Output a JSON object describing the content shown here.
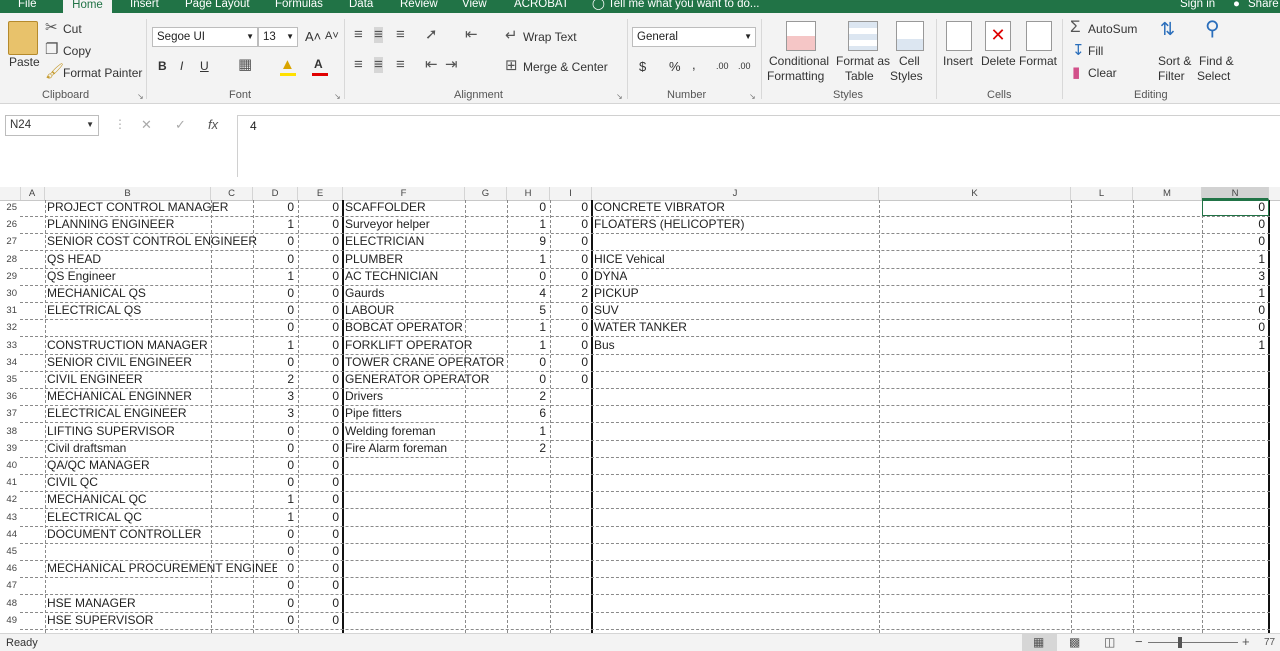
{
  "tabs": {
    "file": "File",
    "home": "Home",
    "insert": "Insert",
    "page_layout": "Page Layout",
    "formulas": "Formulas",
    "data": "Data",
    "review": "Review",
    "view": "View",
    "acrobat": "ACROBAT",
    "tell_me": "Tell me what you want to do...",
    "sign_in": "Sign in",
    "share": "Share"
  },
  "ribbon": {
    "clipboard": {
      "paste": "Paste",
      "cut": "Cut",
      "copy": "Copy",
      "format_painter": "Format Painter",
      "label": "Clipboard"
    },
    "font": {
      "name": "Segoe UI",
      "size": "13",
      "bold": "B",
      "italic": "I",
      "underline": "U",
      "label": "Font"
    },
    "alignment": {
      "wrap_text": "Wrap Text",
      "merge_center": "Merge & Center",
      "label": "Alignment"
    },
    "number": {
      "format": "General",
      "currency": "$",
      "percent": "%",
      "comma": ",",
      "inc_dec": ".00",
      "dec_dec": ".00",
      "label": "Number"
    },
    "styles": {
      "conditional": "Conditional",
      "conditional2": "Formatting",
      "format_as": "Format as",
      "format_as2": "Table",
      "cell": "Cell",
      "cell2": "Styles",
      "label": "Styles"
    },
    "cells": {
      "insert": "Insert",
      "delete": "Delete",
      "format": "Format",
      "label": "Cells"
    },
    "editing": {
      "autosum": "AutoSum",
      "fill": "Fill",
      "clear": "Clear",
      "sort": "Sort &",
      "sort2": "Filter",
      "find": "Find &",
      "find2": "Select",
      "label": "Editing"
    }
  },
  "formula_bar": {
    "name_box": "N24",
    "fx": "fx",
    "value": "4"
  },
  "columns": [
    "A",
    "B",
    "C",
    "D",
    "E",
    "F",
    "G",
    "H",
    "I",
    "J",
    "K",
    "L",
    "M",
    "N"
  ],
  "rows": [
    {
      "n": "25",
      "b": "PROJECT CONTROL MANAGER",
      "d": "0",
      "e": "0",
      "f": "SCAFFOLDER",
      "h": "0",
      "i": "0",
      "j": "CONCRETE VIBRATOR",
      "nn": "0"
    },
    {
      "n": "26",
      "b": "PLANNING ENGINEER",
      "d": "1",
      "e": "0",
      "f": "Surveyor helper",
      "h": "1",
      "i": "0",
      "j": "FLOATERS (HELICOPTER)",
      "nn": "0"
    },
    {
      "n": "27",
      "b": "SENIOR COST CONTROL ENGINEER",
      "d": "0",
      "e": "0",
      "f": "ELECTRICIAN",
      "h": "9",
      "i": "0",
      "j": "",
      "nn": "0"
    },
    {
      "n": "28",
      "b": "QS HEAD",
      "d": "0",
      "e": "0",
      "f": "PLUMBER",
      "h": "1",
      "i": "0",
      "j": "HICE Vehical",
      "nn": "1"
    },
    {
      "n": "29",
      "b": "QS Engineer",
      "d": "1",
      "e": "0",
      "f": "AC TECHNICIAN",
      "h": "0",
      "i": "0",
      "j": "DYNA",
      "nn": "3"
    },
    {
      "n": "30",
      "b": "MECHANICAL QS",
      "d": "0",
      "e": "0",
      "f": "Gaurds",
      "h": "4",
      "i": "2",
      "j": "PICKUP",
      "nn": "1"
    },
    {
      "n": "31",
      "b": "ELECTRICAL QS",
      "d": "0",
      "e": "0",
      "f": "LABOUR",
      "h": "5",
      "i": "0",
      "j": "SUV",
      "nn": "0"
    },
    {
      "n": "32",
      "b": "",
      "d": "0",
      "e": "0",
      "f": "BOBCAT OPERATOR",
      "h": "1",
      "i": "0",
      "j": "WATER TANKER",
      "nn": "0"
    },
    {
      "n": "33",
      "b": "CONSTRUCTION MANAGER",
      "d": "1",
      "e": "0",
      "f": "FORKLIFT OPERATOR",
      "h": "1",
      "i": "0",
      "j": "Bus",
      "nn": "1"
    },
    {
      "n": "34",
      "b": "SENIOR CIVIL ENGINEER",
      "d": "0",
      "e": "0",
      "f": "TOWER CRANE OPERATOR",
      "h": "0",
      "i": "0",
      "j": "",
      "nn": ""
    },
    {
      "n": "35",
      "b": "CIVIL ENGINEER",
      "d": "2",
      "e": "0",
      "f": "GENERATOR OPERATOR",
      "h": "0",
      "i": "0",
      "j": "",
      "nn": ""
    },
    {
      "n": "36",
      "b": "MECHANICAL ENGINNER",
      "d": "3",
      "e": "0",
      "f": "Drivers",
      "h": "2",
      "i": "",
      "j": "",
      "nn": ""
    },
    {
      "n": "37",
      "b": "ELECTRICAL ENGINEER",
      "d": "3",
      "e": "0",
      "f": "Pipe fitters",
      "h": "6",
      "i": "",
      "j": "",
      "nn": ""
    },
    {
      "n": "38",
      "b": "LIFTING SUPERVISOR",
      "d": "0",
      "e": "0",
      "f": "Welding foreman",
      "h": "1",
      "i": "",
      "j": "",
      "nn": ""
    },
    {
      "n": "39",
      "b": "Civil draftsman",
      "d": "0",
      "e": "0",
      "f": "Fire Alarm foreman",
      "h": "2",
      "i": "",
      "j": "",
      "nn": ""
    },
    {
      "n": "40",
      "b": "QA/QC MANAGER",
      "d": "0",
      "e": "0",
      "f": "",
      "h": "",
      "i": "",
      "j": "",
      "nn": ""
    },
    {
      "n": "41",
      "b": "CIVIL QC",
      "d": "0",
      "e": "0",
      "f": "",
      "h": "",
      "i": "",
      "j": "",
      "nn": ""
    },
    {
      "n": "42",
      "b": "MECHANICAL QC",
      "d": "1",
      "e": "0",
      "f": "",
      "h": "",
      "i": "",
      "j": "",
      "nn": ""
    },
    {
      "n": "43",
      "b": "ELECTRICAL QC",
      "d": "1",
      "e": "0",
      "f": "",
      "h": "",
      "i": "",
      "j": "",
      "nn": ""
    },
    {
      "n": "44",
      "b": "DOCUMENT CONTROLLER",
      "d": "0",
      "e": "0",
      "f": "",
      "h": "",
      "i": "",
      "j": "",
      "nn": ""
    },
    {
      "n": "45",
      "b": "",
      "d": "0",
      "e": "0",
      "f": "",
      "h": "",
      "i": "",
      "j": "",
      "nn": ""
    },
    {
      "n": "46",
      "b": "MECHANICAL PROCUREMENT ENGINEER",
      "d": "0",
      "e": "0",
      "f": "",
      "h": "",
      "i": "",
      "j": "",
      "nn": ""
    },
    {
      "n": "47",
      "b": "",
      "d": "0",
      "e": "0",
      "f": "",
      "h": "",
      "i": "",
      "j": "",
      "nn": ""
    },
    {
      "n": "48",
      "b": "HSE MANAGER",
      "d": "0",
      "e": "0",
      "f": "",
      "h": "",
      "i": "",
      "j": "",
      "nn": ""
    },
    {
      "n": "49",
      "b": "HSE SUPERVISOR",
      "d": "0",
      "e": "0",
      "f": "",
      "h": "",
      "i": "",
      "j": "",
      "nn": ""
    }
  ],
  "status": {
    "ready": "Ready",
    "zoom": "77"
  }
}
